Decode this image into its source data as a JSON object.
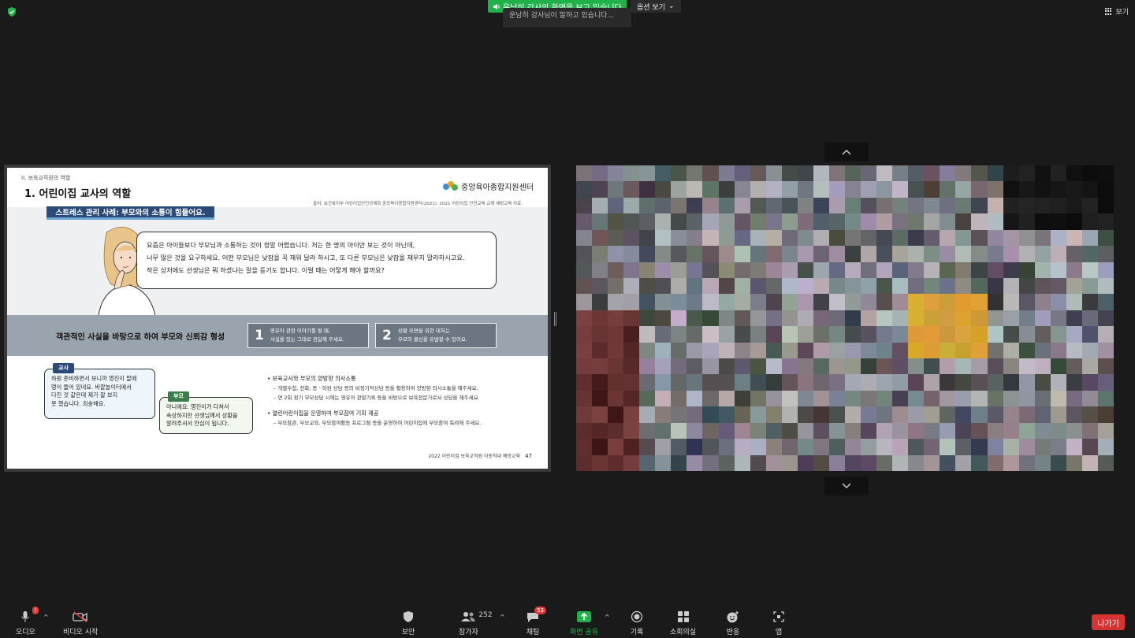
{
  "top": {
    "share_banner": "운남히 강사의 화면을 보고 있습니다",
    "view_options": "옵션 보기",
    "notice": "운남히 강사님이 말하고 있습니다...",
    "view_button": "보기",
    "accent_green": "#20b14a"
  },
  "slide": {
    "section": "II. 보육교직원의 역할",
    "title": "1. 어린이집 교사의 역할",
    "logo_text": "중앙육아종합지원센터",
    "source": "출처: 보건복지부 어린이집안전공제회 중앙육아종합지원센터(2021). 2021 어린이집 안전교육 교재 예방교육 자료.",
    "stress_tab": "스트레스 관리 사례: 부모와의 소통이 힘들어요.",
    "speech_lines": [
      "요즘은 아이들보다 부모님과 소통하는 것이 정말 어렵습니다. 저는 한 명의 아이만 보는 것이 아닌데,",
      "너무 많은 것을 요구하세요. 어떤 부모님은 낮잠을 꼭 재워 달라 하시고, 또 다른 부모님은 낮잠을 재우지 말라하시고요.",
      "작은 상처에도 선생님은 뭐 하셨냐는 말을 듣기도 합니다. 이럴 때는 어떻게 해야 할까요?"
    ],
    "band_title": "객관적인 사실을 바탕으로 하여 부모와 신뢰감 형성",
    "tip1": {
      "num": "1",
      "line1": "영유아 관련 이야기를 할 때,",
      "line2": "사실을 있는 그대로 전달해 주세요."
    },
    "tip2": {
      "num": "2",
      "line1": "상황 모면을 위한 대처는",
      "line2": "부모의 불신을 유발할 수 있어요."
    },
    "teacher_tag": "교사",
    "teacher_lines": [
      "하원 준비하면서 보니까 영진이 팔에",
      "멍이 들어 있네요. 바깥놀이터에서",
      "다친 것 같은데 제가 잘 보지",
      "못 했습니다. 죄송해요."
    ],
    "parent_tag": "부모",
    "parent_lines": [
      "아니에요. 영진이가 다쳐서",
      "속상하지만 선생님께서 상황을",
      "알려주셔서 안심이 됩니다."
    ],
    "bullet1": "보육교사와 부모의 양방향 의사소통",
    "bullet1_subs": [
      "– 개별수첩, 전화, 등 · 하원 상담 등의 비정기적상담 등을 활용하여 양방향 의사소통을 해주세요.",
      "– 연 2회 정기 부모상담 시에는 영유아 관찰기록 등을 바탕으로 보육전문가로서 상담을 해주세요."
    ],
    "bullet2": "열린어린이집을 운영하여 부모참여 기회 제공",
    "bullet2_subs": [
      "– 부모참관, 부모교육, 부모참여활동 프로그램 등을 운영하여 어린이집에 부모참여 독려해 주세요."
    ],
    "footer_text": "2022 어린이집 보육교직원  아동학대 예방교육",
    "page": "47",
    "navy": "#2b4a78"
  },
  "toolbar": {
    "audio": "오디오",
    "audio_badge": "!",
    "video": "비디오 시작",
    "security": "보안",
    "participants": "참가자",
    "participants_count": "252",
    "chat": "채팅",
    "chat_badge": "53",
    "share": "화면 공유",
    "record": "기록",
    "breakout": "소회의실",
    "reactions": "반응",
    "apps": "앱",
    "leave": "나가기",
    "leave_color": "#d63333"
  }
}
